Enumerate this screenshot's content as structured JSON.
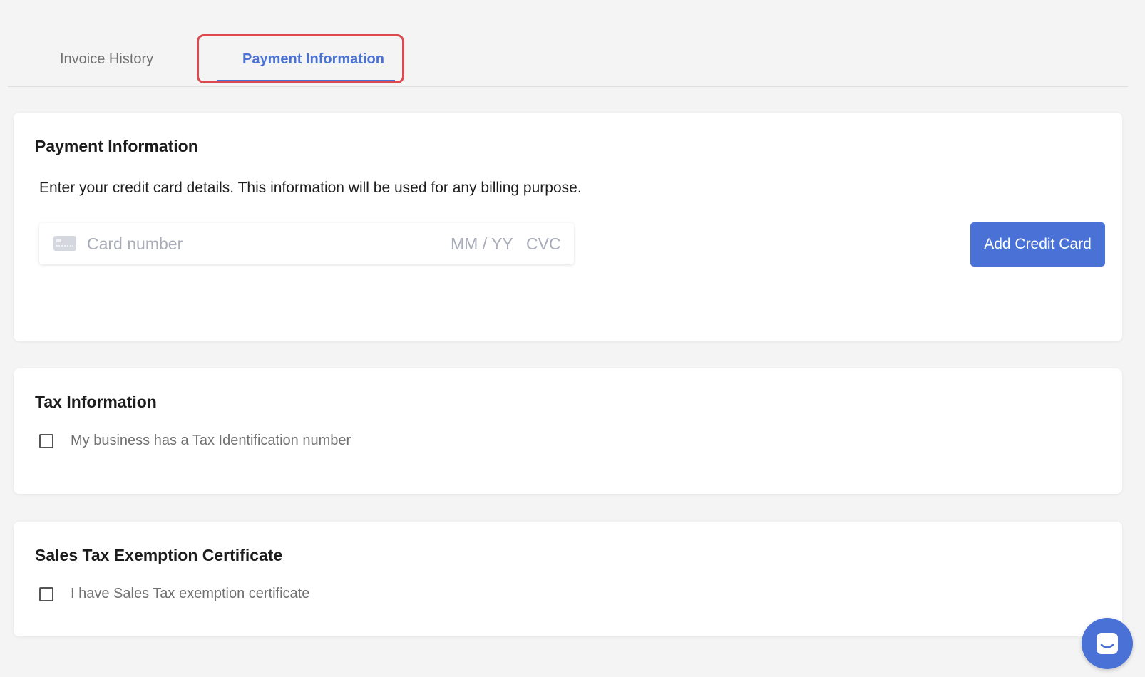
{
  "tabs": [
    {
      "label": "Invoice History"
    },
    {
      "label": "Payment Information"
    }
  ],
  "payment": {
    "title": "Payment Information",
    "description": "Enter your credit card details. This information will be used for any billing purpose.",
    "card_number_placeholder": "Card number",
    "expiry_placeholder": "MM / YY",
    "cvc_placeholder": "CVC",
    "add_button": "Add Credit Card"
  },
  "tax": {
    "title": "Tax Information",
    "checkbox_label": "My business has a Tax Identification number"
  },
  "sales": {
    "title": "Sales Tax Exemption Certificate",
    "checkbox_label": "I have Sales Tax exemption certificate"
  },
  "colors": {
    "accent": "#4a72d6",
    "highlight": "#dc4a4f",
    "background": "#f4f4f4"
  },
  "icons": [
    "credit-card-icon",
    "chat-icon"
  ]
}
